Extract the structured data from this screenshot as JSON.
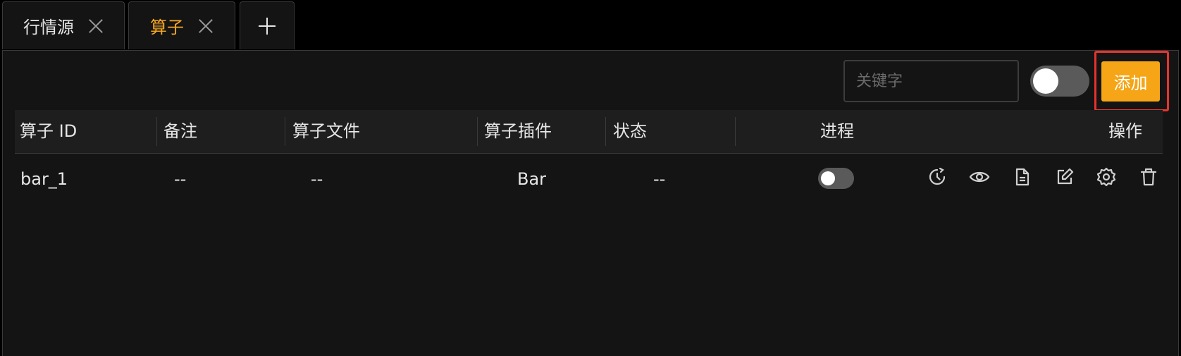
{
  "tabs": [
    {
      "label": "行情源",
      "active": false
    },
    {
      "label": "算子",
      "active": true
    }
  ],
  "toolbar": {
    "search_placeholder": "关键字",
    "add_label": "添加"
  },
  "table": {
    "columns": [
      "算子 ID",
      "备注",
      "算子文件",
      "算子插件",
      "状态",
      "进程",
      "操作"
    ],
    "rows": [
      {
        "id": "bar_1",
        "note": "--",
        "file": "--",
        "plugin": "Bar",
        "status": "--",
        "process_on": false
      }
    ]
  },
  "colors": {
    "accent": "#f5a516",
    "background": "#141414",
    "highlight": "#e8332e"
  },
  "icons": {
    "row_actions": [
      "history-icon",
      "view-icon",
      "file-icon",
      "edit-icon",
      "settings-icon",
      "delete-icon"
    ]
  }
}
